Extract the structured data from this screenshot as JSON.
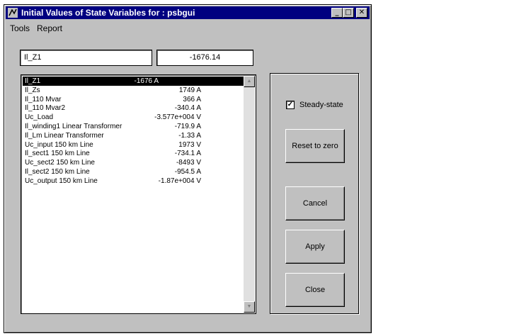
{
  "window": {
    "title": "Initial Values of State Variables for : psbgui"
  },
  "titlebar_buttons": {
    "minimize": "_",
    "maximize": "□",
    "close": "✕"
  },
  "menu": [
    "Tools",
    "Report"
  ],
  "selected": {
    "name": "Il_Z1",
    "value": "-1676.14"
  },
  "list": [
    {
      "name": "Il_Z1",
      "value": "-1676 A"
    },
    {
      "name": "Il_Zs",
      "value": "1749 A"
    },
    {
      "name": "Il_110 Mvar",
      "value": "366 A"
    },
    {
      "name": "Il_110 Mvar2",
      "value": "-340.4 A"
    },
    {
      "name": "Uc_Load",
      "value": "-3.577e+004 V"
    },
    {
      "name": "Il_winding1 Linear Transformer",
      "value": "-719.9 A"
    },
    {
      "name": "Il_Lm Linear Transformer",
      "value": "-1.33 A"
    },
    {
      "name": "Uc_input 150 km Line",
      "value": "1973 V"
    },
    {
      "name": "Il_sect1 150 km Line",
      "value": "-734.1 A"
    },
    {
      "name": "Uc_sect2 150 km Line",
      "value": "-8493 V"
    },
    {
      "name": "Il_sect2 150 km Line",
      "value": "-954.5 A"
    },
    {
      "name": "Uc_output 150 km Line",
      "value": "-1.87e+004 V"
    }
  ],
  "steady_state": {
    "label": "Steady-state",
    "checked": true,
    "mark": "✓"
  },
  "buttons": {
    "reset": "Reset to zero",
    "cancel": "Cancel",
    "apply": "Apply",
    "close": "Close"
  },
  "scroll_arrows": {
    "up": "▲",
    "down": "▼"
  }
}
